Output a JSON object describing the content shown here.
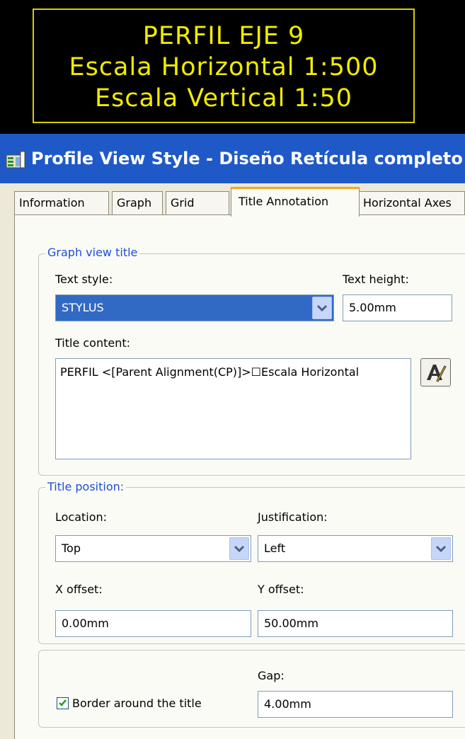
{
  "preview": {
    "lines": [
      "PERFIL EJE 9",
      "Escala Horizontal 1:500",
      "Escala Vertical 1:50"
    ],
    "text_color": "#f2ec00",
    "frame_color": "#d8cf00"
  },
  "window": {
    "title": "Profile View Style - Diseño Retícula completo",
    "icon": "style-dialog-icon"
  },
  "tabs": [
    "Information",
    "Graph",
    "Grid",
    "Title Annotation",
    "Horizontal Axes"
  ],
  "active_tab": "Title Annotation",
  "graph_view_title": {
    "group_label": "Graph view title",
    "text_style_label": "Text style:",
    "text_style_value": "STYLUS",
    "text_height_label": "Text height:",
    "text_height_value": "5.00mm",
    "title_content_label": "Title content:",
    "title_content_value": "PERFIL <[Parent Alignment(CP)]>☐Escala Horizontal",
    "text_editor_icon": "text-field-editor-icon"
  },
  "title_position": {
    "group_label": "Title position:",
    "location_label": "Location:",
    "location_value": "Top",
    "justification_label": "Justification:",
    "justification_value": "Left",
    "x_offset_label": "X offset:",
    "x_offset_value": "0.00mm",
    "y_offset_label": "Y offset:",
    "y_offset_value": "50.00mm"
  },
  "border": {
    "checkbox_label": "Border around the title",
    "checked": true,
    "gap_label": "Gap:",
    "gap_value": "4.00mm"
  },
  "colors": {
    "titlebar": "#1f59c8",
    "selection": "#316ac5",
    "group_label": "#1d4fd6",
    "active_tab_accent": "#f5a623"
  }
}
